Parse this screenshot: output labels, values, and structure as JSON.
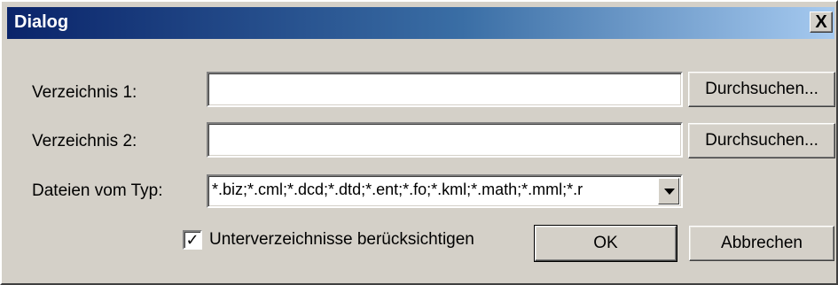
{
  "window": {
    "title": "Dialog",
    "close_symbol": "X"
  },
  "dir1": {
    "label": "Verzeichnis 1:",
    "value": "",
    "browse_label": "Durchsuchen..."
  },
  "dir2": {
    "label": "Verzeichnis 2:",
    "value": "",
    "browse_label": "Durchsuchen..."
  },
  "filetypes": {
    "label": "Dateien vom Typ:",
    "value": "*.biz;*.cml;*.dcd;*.dtd;*.ent;*.fo;*.kml;*.math;*.mml;*.r"
  },
  "subdirs": {
    "label": "Unterverzeichnisse berücksichtigen",
    "checked": true,
    "check_symbol": "✓"
  },
  "buttons": {
    "ok": "OK",
    "cancel": "Abbrechen"
  },
  "icons": {
    "close": "close-icon",
    "dropdown": "chevron-down-icon",
    "check": "checkmark-icon"
  },
  "colors": {
    "titlebar_start": "#0a246a",
    "titlebar_end": "#a6caf0",
    "face": "#d4d0c8"
  }
}
